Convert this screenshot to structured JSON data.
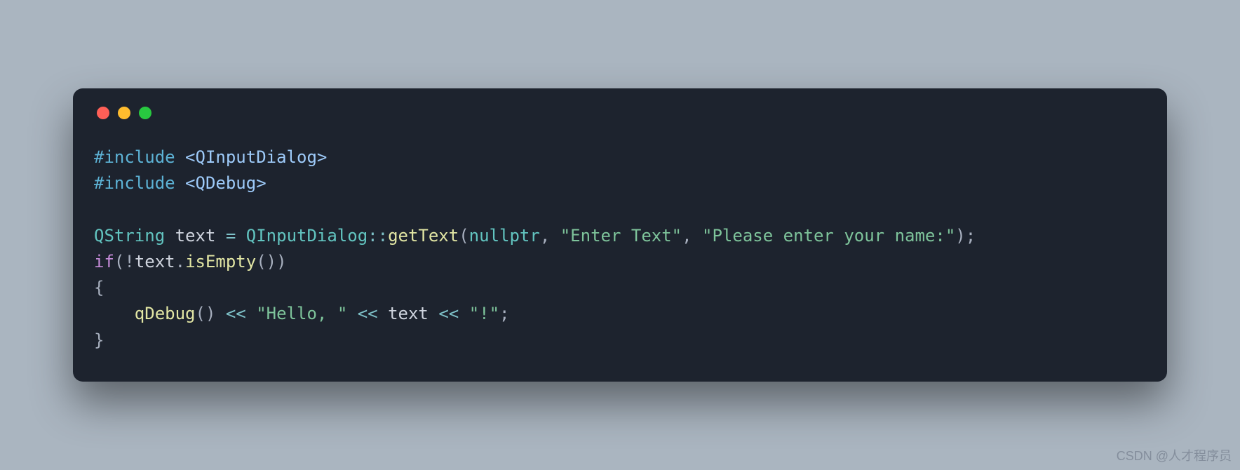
{
  "window": {
    "traffic_lights": [
      "red",
      "yellow",
      "green"
    ]
  },
  "code": {
    "tokens": [
      [
        {
          "c": "tk-pre",
          "t": "#include"
        },
        {
          "c": "tk-punc",
          "t": " "
        },
        {
          "c": "tk-inc",
          "t": "<QInputDialog>"
        }
      ],
      [
        {
          "c": "tk-pre",
          "t": "#include"
        },
        {
          "c": "tk-punc",
          "t": " "
        },
        {
          "c": "tk-inc",
          "t": "<QDebug>"
        }
      ],
      [],
      [
        {
          "c": "tk-type",
          "t": "QString"
        },
        {
          "c": "tk-punc",
          "t": " "
        },
        {
          "c": "tk-var",
          "t": "text"
        },
        {
          "c": "tk-punc",
          "t": " "
        },
        {
          "c": "tk-op",
          "t": "="
        },
        {
          "c": "tk-punc",
          "t": " "
        },
        {
          "c": "tk-type",
          "t": "QInputDialog"
        },
        {
          "c": "tk-op",
          "t": "::"
        },
        {
          "c": "tk-func",
          "t": "getText"
        },
        {
          "c": "tk-punc",
          "t": "("
        },
        {
          "c": "tk-type",
          "t": "nullptr"
        },
        {
          "c": "tk-punc",
          "t": ", "
        },
        {
          "c": "tk-str",
          "t": "\"Enter Text\""
        },
        {
          "c": "tk-punc",
          "t": ", "
        },
        {
          "c": "tk-str",
          "t": "\"Please enter your name:\""
        },
        {
          "c": "tk-punc",
          "t": ");"
        }
      ],
      [
        {
          "c": "tk-kw",
          "t": "if"
        },
        {
          "c": "tk-punc",
          "t": "(!"
        },
        {
          "c": "tk-var",
          "t": "text"
        },
        {
          "c": "tk-punc",
          "t": "."
        },
        {
          "c": "tk-func",
          "t": "isEmpty"
        },
        {
          "c": "tk-punc",
          "t": "())"
        }
      ],
      [
        {
          "c": "tk-punc",
          "t": "{"
        }
      ],
      [
        {
          "c": "tk-punc",
          "t": "    "
        },
        {
          "c": "tk-func",
          "t": "qDebug"
        },
        {
          "c": "tk-punc",
          "t": "() "
        },
        {
          "c": "tk-op",
          "t": "<<"
        },
        {
          "c": "tk-punc",
          "t": " "
        },
        {
          "c": "tk-str",
          "t": "\"Hello, \""
        },
        {
          "c": "tk-punc",
          "t": " "
        },
        {
          "c": "tk-op",
          "t": "<<"
        },
        {
          "c": "tk-punc",
          "t": " "
        },
        {
          "c": "tk-var",
          "t": "text"
        },
        {
          "c": "tk-punc",
          "t": " "
        },
        {
          "c": "tk-op",
          "t": "<<"
        },
        {
          "c": "tk-punc",
          "t": " "
        },
        {
          "c": "tk-str",
          "t": "\"!\""
        },
        {
          "c": "tk-punc",
          "t": ";"
        }
      ],
      [
        {
          "c": "tk-punc",
          "t": "}"
        }
      ]
    ]
  },
  "watermark": "CSDN @人才程序员"
}
